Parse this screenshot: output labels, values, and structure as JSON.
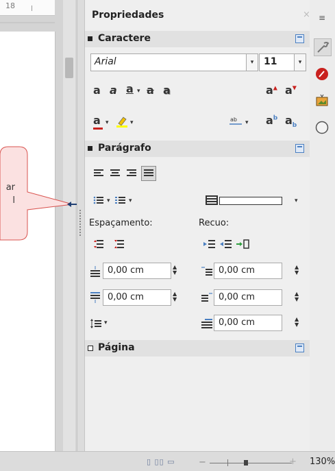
{
  "ruler": {
    "number": "18"
  },
  "callout": {
    "line1": "ar",
    "line2": "l"
  },
  "panel": {
    "title": "Propriedades",
    "close_glyph": "×",
    "character": {
      "title": "Caractere",
      "font_name": "Arial",
      "font_size": "11",
      "tools": [
        "bold",
        "italic",
        "underline",
        "strikethrough",
        "shadow",
        "grow-font",
        "shrink-font",
        "font-color",
        "highlight",
        "char-spacing",
        "superscript",
        "subscript"
      ]
    },
    "paragraph": {
      "title": "Parágrafo",
      "alignments": [
        "left",
        "center",
        "right",
        "justified"
      ],
      "active_alignment": "justified",
      "spacing_label": "Espaçamento:",
      "indent_label": "Recuo:",
      "above_value": "0,00 cm",
      "below_value": "0,00 cm",
      "before_value": "0,00 cm",
      "after_value": "0,00 cm",
      "first_line_value": "0,00 cm"
    },
    "page": {
      "title": "Página"
    }
  },
  "tabs": [
    "properties",
    "styles",
    "gallery",
    "navigator"
  ],
  "status": {
    "zoom": "130%"
  },
  "colors": {
    "font_color": "#c9211e",
    "highlight": "#ffff00",
    "accent": "#4a7fc1"
  }
}
